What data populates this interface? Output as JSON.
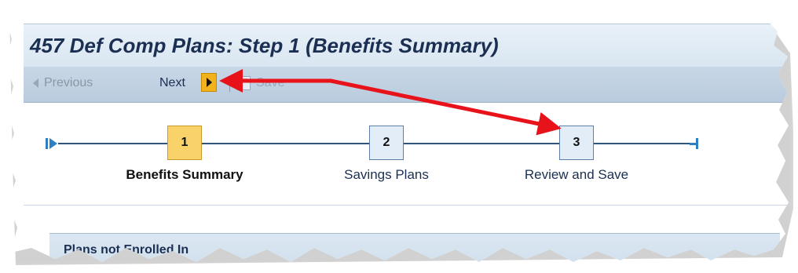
{
  "page": {
    "title": "457 Def Comp Plans: Step 1  (Benefits Summary)"
  },
  "toolbar": {
    "previous_label": "Previous",
    "next_label": "Next",
    "save_label": "Save"
  },
  "roadmap": {
    "steps": [
      {
        "number": "1",
        "label": "Benefits Summary",
        "state": "current"
      },
      {
        "number": "2",
        "label": "Savings Plans",
        "state": "pending"
      },
      {
        "number": "3",
        "label": "Review and Save",
        "state": "pending"
      }
    ]
  },
  "section": {
    "title": "Plans not Enrolled In"
  },
  "colors": {
    "title_text": "#1b2f52",
    "toolbar_bg": "#c8d7e6",
    "next_button": "#f1b21c",
    "active_step": "#f9d26a",
    "annotation_arrow": "#e8121b"
  },
  "icons": [
    "previous-arrow-icon",
    "next-arrow-icon",
    "save-icon",
    "roadmap-start-icon",
    "roadmap-end-icon"
  ]
}
